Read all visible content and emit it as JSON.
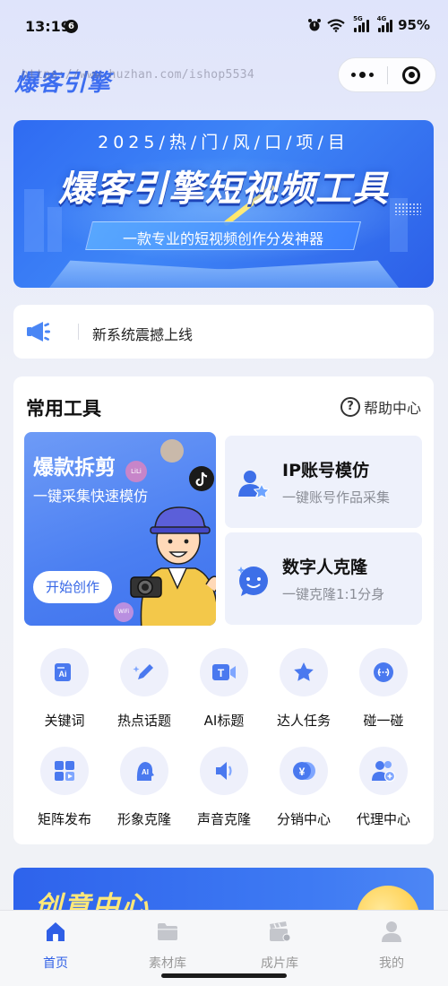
{
  "status_bar": {
    "time": "13:19",
    "notif_count": "6",
    "battery": "95%",
    "net1": "5G",
    "net2": "4G"
  },
  "header": {
    "logo": "爆客引擎",
    "watermark": "https://www.huzhan.com/ishop5534"
  },
  "banner": {
    "subtitle": "2025/热/门/风/口/项/目",
    "title": "爆客引擎短视频工具",
    "tagline": "一款专业的短视频创作分发神器"
  },
  "notice": {
    "text": "新系统震撼上线"
  },
  "tools": {
    "title": "常用工具",
    "help_label": "帮助中心",
    "feature": {
      "title": "爆款拆剪",
      "desc": "一键采集快速模仿",
      "button": "开始创作",
      "badge1": "LiLi",
      "badge2": "WiFi"
    },
    "side_cards": [
      {
        "title": "IP账号模仿",
        "desc": "一键账号作品采集"
      },
      {
        "title": "数字人克隆",
        "desc": "一键克隆1:1分身"
      }
    ],
    "grid": [
      {
        "label": "关键词",
        "icon": "keyword-ai-icon"
      },
      {
        "label": "热点话题",
        "icon": "pen-sparkle-icon"
      },
      {
        "label": "AI标题",
        "icon": "title-video-icon"
      },
      {
        "label": "达人任务",
        "icon": "star-icon"
      },
      {
        "label": "碰一碰",
        "icon": "nfc-icon"
      },
      {
        "label": "矩阵发布",
        "icon": "matrix-icon"
      },
      {
        "label": "形象克隆",
        "icon": "avatar-ai-icon"
      },
      {
        "label": "声音克隆",
        "icon": "speaker-icon"
      },
      {
        "label": "分销中心",
        "icon": "yen-coin-icon"
      },
      {
        "label": "代理中心",
        "icon": "agent-users-icon"
      }
    ]
  },
  "creative": {
    "title": "创意中心"
  },
  "tabbar": {
    "tabs": [
      {
        "label": "首页",
        "icon": "home-icon",
        "active": true
      },
      {
        "label": "素材库",
        "icon": "folder-icon",
        "active": false
      },
      {
        "label": "成片库",
        "icon": "clapper-icon",
        "active": false
      },
      {
        "label": "我的",
        "icon": "user-icon",
        "active": false
      }
    ]
  },
  "colors": {
    "accent": "#3c6df0",
    "tab_active": "#2f5fe6",
    "tab_inactive": "#999999"
  }
}
